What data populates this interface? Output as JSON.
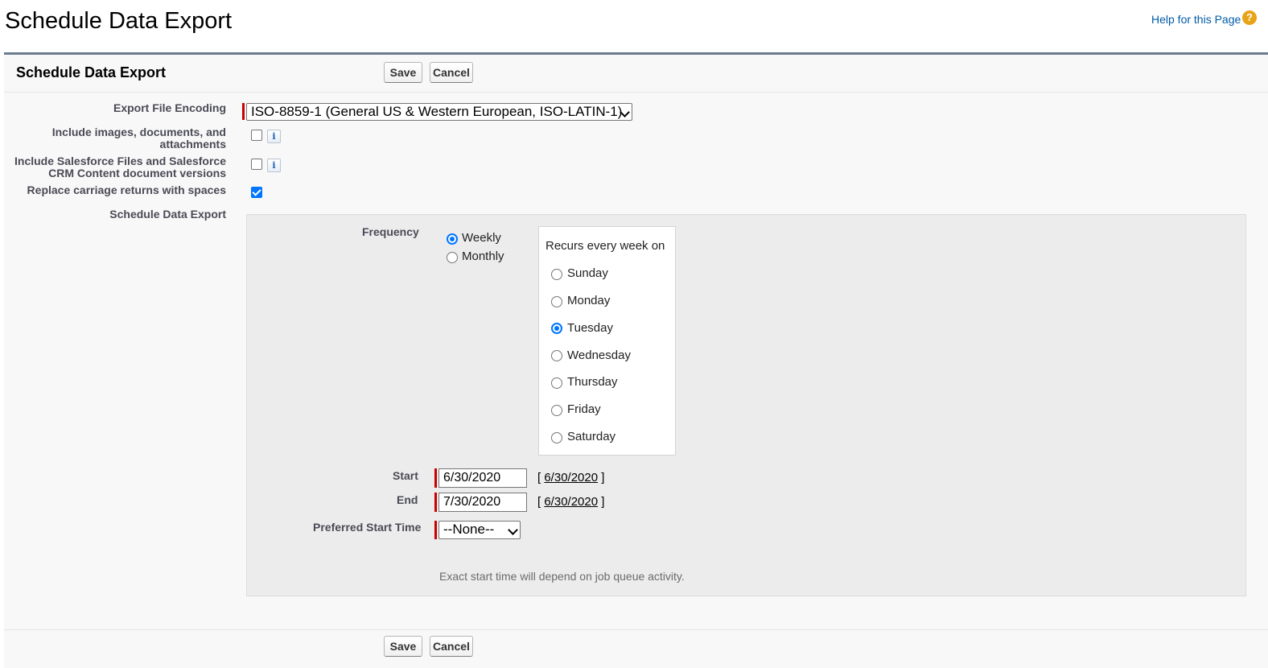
{
  "page": {
    "title": "Schedule Data Export",
    "help_link": "Help for this Page",
    "help_icon": "question-circle-icon"
  },
  "block": {
    "title": "Schedule Data Export",
    "save_label": "Save",
    "cancel_label": "Cancel"
  },
  "form": {
    "encoding_label": "Export File Encoding",
    "encoding_value": "ISO-8859-1 (General US & Western European, ISO-LATIN-1)",
    "include_images_label_1": "Include images, documents, and",
    "include_images_label_2": "attachments",
    "include_images_checked": false,
    "include_files_label_1": "Include Salesforce Files and Salesforce",
    "include_files_label_2": "CRM Content document versions",
    "include_files_checked": false,
    "replace_cr_label": "Replace carriage returns with spaces",
    "replace_cr_checked": true,
    "schedule_label": "Schedule Data Export",
    "info_icon_glyph": "i"
  },
  "schedule": {
    "frequency_label": "Frequency",
    "frequency_options": [
      "Weekly",
      "Monthly"
    ],
    "frequency_selected": "Weekly",
    "recurs_label": "Recurs every week on",
    "days": [
      "Sunday",
      "Monday",
      "Tuesday",
      "Wednesday",
      "Thursday",
      "Friday",
      "Saturday"
    ],
    "day_selected": "Tuesday",
    "start_label": "Start",
    "start_value": "6/30/2020",
    "start_link": "6/30/2020",
    "end_label": "End",
    "end_value": "7/30/2020",
    "end_link": "6/30/2020",
    "preferred_time_label": "Preferred Start Time",
    "preferred_time_value": "--None--",
    "note": "Exact start time will depend on job queue activity."
  },
  "colors": {
    "required": "#c00000",
    "accent": "#0075ff",
    "header_border": "#6d7b8f",
    "link": "#015ba7"
  }
}
